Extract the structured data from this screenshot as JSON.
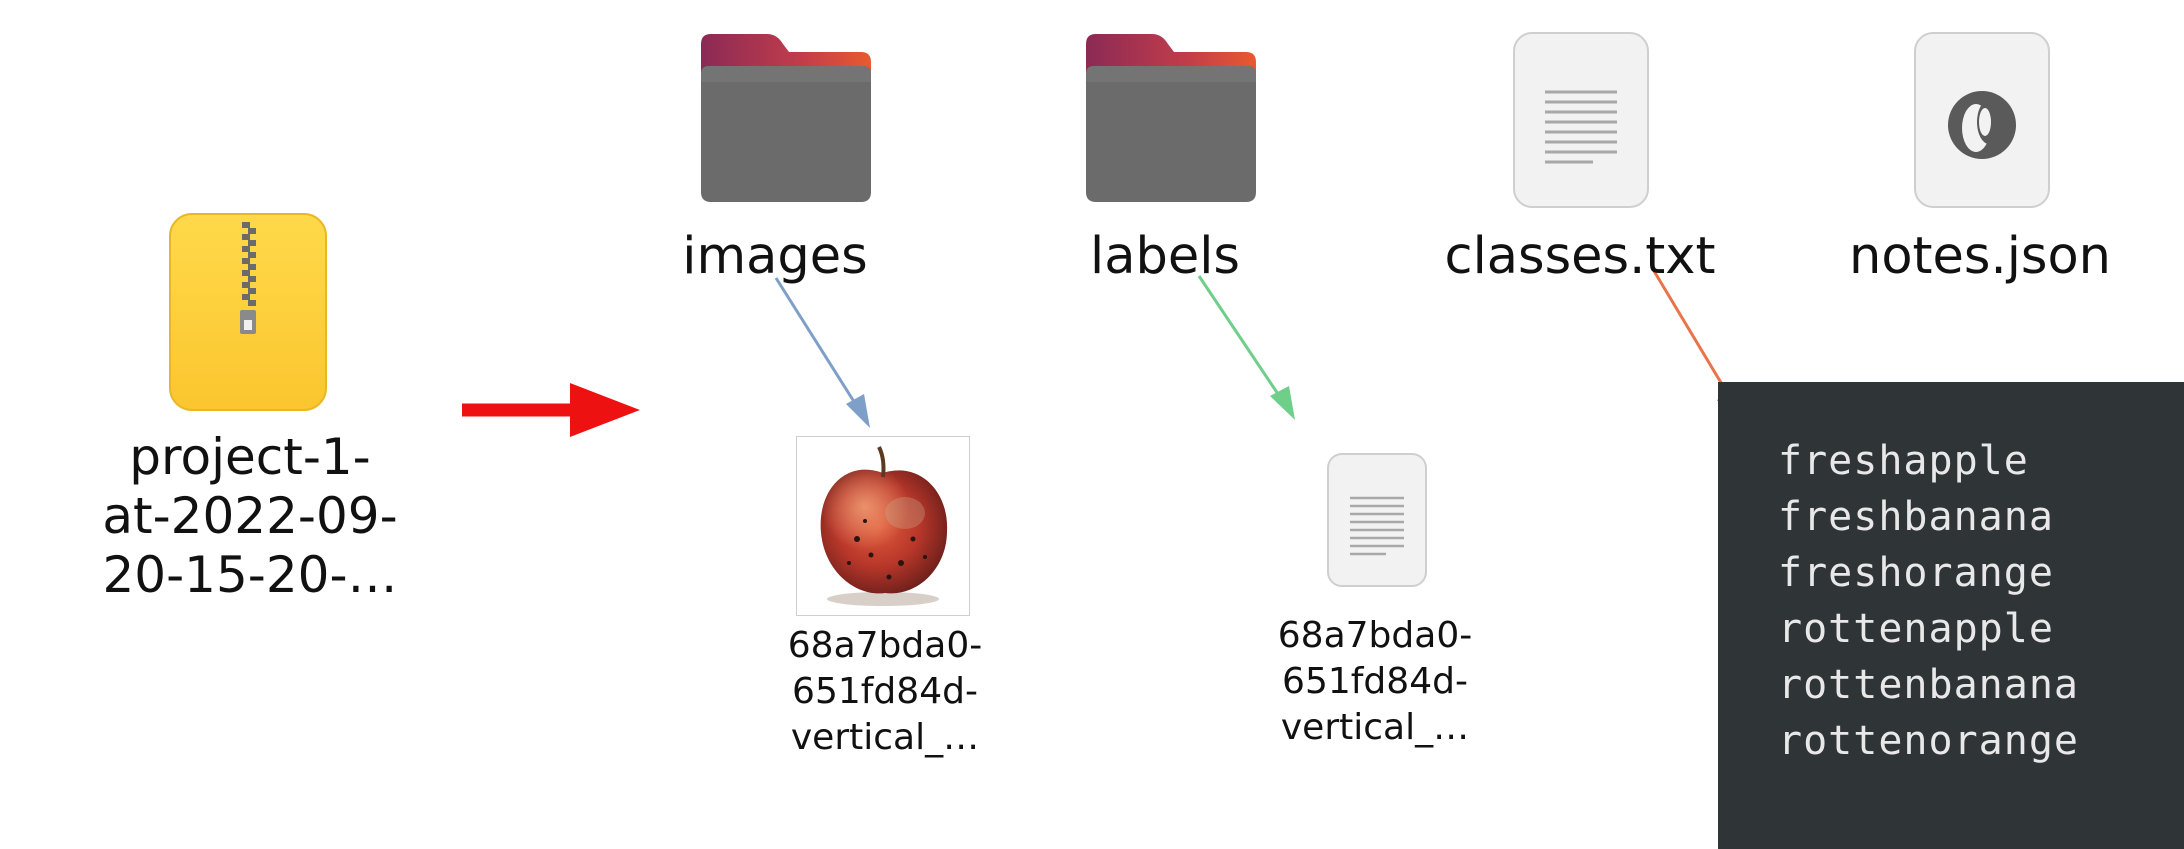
{
  "archive": {
    "label_lines": [
      "project-1-",
      "at-2022-09-",
      "20-15-20-…"
    ],
    "icon": "zip-archive-icon"
  },
  "folders": [
    {
      "label": "images",
      "icon": "folder-icon"
    },
    {
      "label": "labels",
      "icon": "folder-icon"
    }
  ],
  "files": [
    {
      "label": "classes.txt",
      "icon": "text-file-icon"
    },
    {
      "label": "notes.json",
      "icon": "json-file-icon"
    }
  ],
  "image_file": {
    "label_lines": [
      "68a7bda0-",
      "651fd84d-",
      "vertical_…"
    ],
    "icon": "apple-thumbnail-icon"
  },
  "label_file": {
    "label_lines": [
      "68a7bda0-",
      "651fd84d-",
      "vertical_…"
    ],
    "icon": "text-file-icon"
  },
  "classes_content": [
    "freshapple",
    "freshbanana",
    "freshorange",
    "rottenapple",
    "rottenbanana",
    "rottenorange"
  ],
  "colors": {
    "main_arrow": "#ee1111",
    "images_arrow": "#7e9fc8",
    "labels_arrow": "#6fce8a",
    "classes_arrow": "#e9744a",
    "terminal_bg": "#2f3437",
    "zip_yellow": "#fdd03f"
  }
}
